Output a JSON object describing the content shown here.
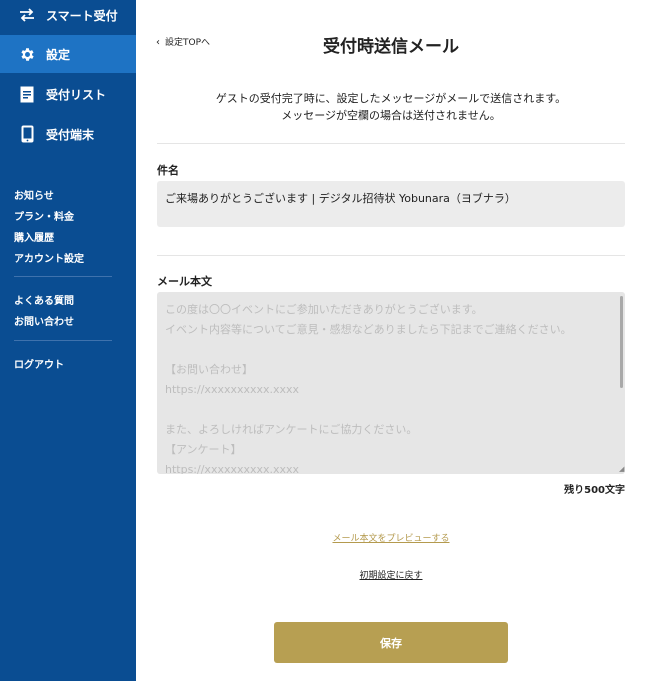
{
  "sidebar": {
    "nav": [
      {
        "label": "スマート受付",
        "icon": "swap-arrows-icon"
      },
      {
        "label": "設定",
        "icon": "gear-icon",
        "active": true
      },
      {
        "label": "受付リスト",
        "icon": "document-icon"
      },
      {
        "label": "受付端末",
        "icon": "tablet-icon"
      }
    ],
    "links": {
      "news": "お知らせ",
      "plan": "プラン・料金",
      "history": "購入履歴",
      "account": "アカウント設定",
      "faq": "よくある質問",
      "contact": "お問い合わせ",
      "logout": "ログアウト"
    }
  },
  "header": {
    "back_label": "設定TOPへ",
    "title": "受付時送信メール"
  },
  "description": {
    "line1": "ゲストの受付完了時に、設定したメッセージがメールで送信されます。",
    "line2": "メッセージが空欄の場合は送付されません。"
  },
  "subject": {
    "label": "件名",
    "value": "ご来場ありがとうございます | デジタル招待状 Yobunara（ヨブナラ）"
  },
  "mail_body": {
    "label": "メール本文",
    "placeholder_lines": [
      "この度は〇〇イベントにご参加いただきありがとうございます。",
      "イベント内容等についてご意見・感想などありましたら下記までご連絡ください。",
      "",
      "【お問い合わせ】",
      "https://xxxxxxxxxx.xxxx",
      "",
      "また、よろしければアンケートにご協力ください。",
      "【アンケート】",
      "https://xxxxxxxxxx.xxxx"
    ],
    "remaining": "残り500文字"
  },
  "actions": {
    "preview_label": "メール本文をプレビューする",
    "reset_label": "初期設定に戻す",
    "save_label": "保存"
  }
}
